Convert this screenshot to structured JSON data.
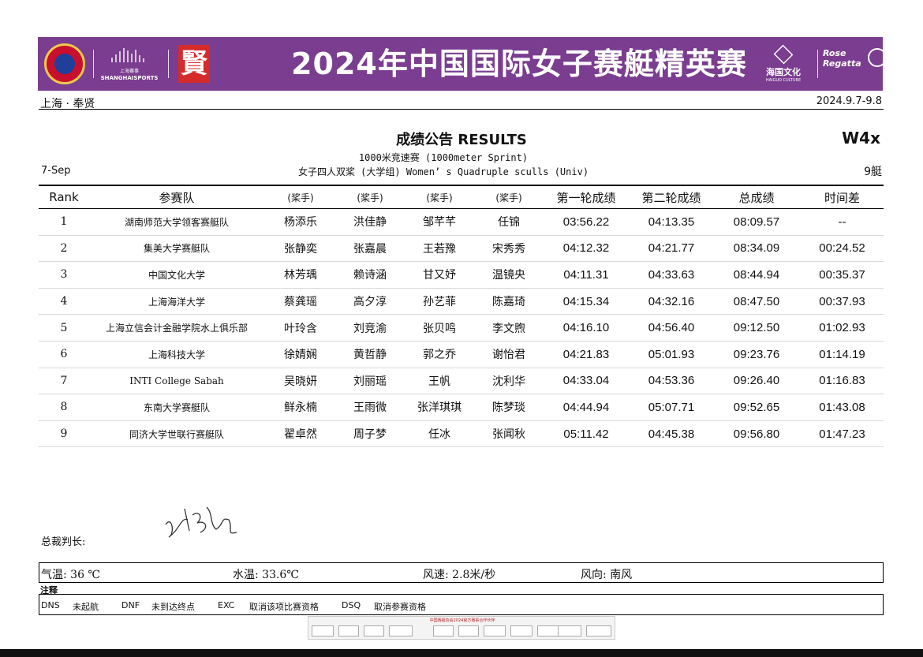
{
  "banner": {
    "title": "2024年中国国际女子赛艇精英赛",
    "shanghai_small": "上海赛事",
    "shanghai_sports": "SHANGHAISPORTS",
    "fengxian_mark": "賢",
    "haiguo": "海国文化",
    "haiguo_sub": "HAIGUO CULTURE",
    "rose_line1": "Rose",
    "rose_line2": "Regatta",
    "color": "#7a3d8f"
  },
  "header": {
    "location": "上海 · 奉贤",
    "date_range": "2024.9.7-9.8",
    "title": "成绩公告 RESULTS",
    "event_code": "W4x",
    "subtitle1": "1000米竞速赛 (1000meter Sprint)",
    "subtitle2": "女子四人双桨 (大学组) Women’ s Quadruple sculls (Univ)",
    "date": "7-Sep",
    "boats": "9艇"
  },
  "table": {
    "headers": [
      "Rank",
      "参赛队",
      "(桨手)",
      "(桨手)",
      "(桨手)",
      "(桨手)",
      "第一轮成绩",
      "第二轮成绩",
      "总成绩",
      "时间差"
    ],
    "rows": [
      {
        "rank": "1",
        "team": "湖南师范大学领客赛艇队",
        "r1": "杨添乐",
        "r2": "洪佳静",
        "r3": "邹芊芊",
        "r4": "任锦",
        "t1": "03:56.22",
        "t2": "04:13.35",
        "total": "08:09.57",
        "diff": "--"
      },
      {
        "rank": "2",
        "team": "集美大学赛艇队",
        "r1": "张静奕",
        "r2": "张嘉晨",
        "r3": "王若豫",
        "r4": "宋秀秀",
        "t1": "04:12.32",
        "t2": "04:21.77",
        "total": "08:34.09",
        "diff": "00:24.52"
      },
      {
        "rank": "3",
        "team": "中国文化大学",
        "r1": "林芳瑀",
        "r2": "赖诗涵",
        "r3": "甘又妤",
        "r4": "温镜央",
        "t1": "04:11.31",
        "t2": "04:33.63",
        "total": "08:44.94",
        "diff": "00:35.37"
      },
      {
        "rank": "4",
        "team": "上海海洋大学",
        "r1": "蔡龚瑶",
        "r2": "高夕淳",
        "r3": "孙艺菲",
        "r4": "陈嘉琦",
        "t1": "04:15.34",
        "t2": "04:32.16",
        "total": "08:47.50",
        "diff": "00:37.93"
      },
      {
        "rank": "5",
        "team": "上海立信会计金融学院水上俱乐部",
        "r1": "叶玲含",
        "r2": "刘竞渝",
        "r3": "张贝鸣",
        "r4": "李文煦",
        "t1": "04:16.10",
        "t2": "04:56.40",
        "total": "09:12.50",
        "diff": "01:02.93"
      },
      {
        "rank": "6",
        "team": "上海科技大学",
        "r1": "徐婧娴",
        "r2": "黄哲静",
        "r3": "郭之乔",
        "r4": "谢怡君",
        "t1": "04:21.83",
        "t2": "05:01.93",
        "total": "09:23.76",
        "diff": "01:14.19"
      },
      {
        "rank": "7",
        "team": "INTI College Sabah",
        "r1": "吴晓妍",
        "r2": "刘丽瑶",
        "r3": "王帆",
        "r4": "沈利华",
        "t1": "04:33.04",
        "t2": "04:53.36",
        "total": "09:26.40",
        "diff": "01:16.83"
      },
      {
        "rank": "8",
        "team": "东南大学赛艇队",
        "r1": "鲜永楠",
        "r2": "王雨微",
        "r3": "张洋琪琪",
        "r4": "陈梦琰",
        "t1": "04:44.94",
        "t2": "05:07.71",
        "total": "09:52.65",
        "diff": "01:43.08"
      },
      {
        "rank": "9",
        "team": "同济大学世联行赛艇队",
        "r1": "翟卓然",
        "r2": "周子梦",
        "r3": "任冰",
        "r4": "张闻秋",
        "t1": "05:11.42",
        "t2": "04:45.38",
        "total": "09:56.80",
        "diff": "01:47.23"
      }
    ]
  },
  "footer": {
    "judge_label": "总裁判长:",
    "weather": {
      "air": "气温:  36 ℃",
      "water": "水温:  33.6℃",
      "wind_speed": "风速: 2.8米/秒",
      "wind_dir": "风向: 南风"
    },
    "notes_label": "注释",
    "notes": [
      {
        "code": "DNS",
        "desc": "未起航"
      },
      {
        "code": "DNF",
        "desc": "未到达终点"
      },
      {
        "code": "EXC",
        "desc": "取消该项比赛资格"
      },
      {
        "code": "DSQ",
        "desc": "取消参赛资格"
      }
    ],
    "sponsor_line": "中国赛艇协会2024官方赛事合作伙伴"
  }
}
